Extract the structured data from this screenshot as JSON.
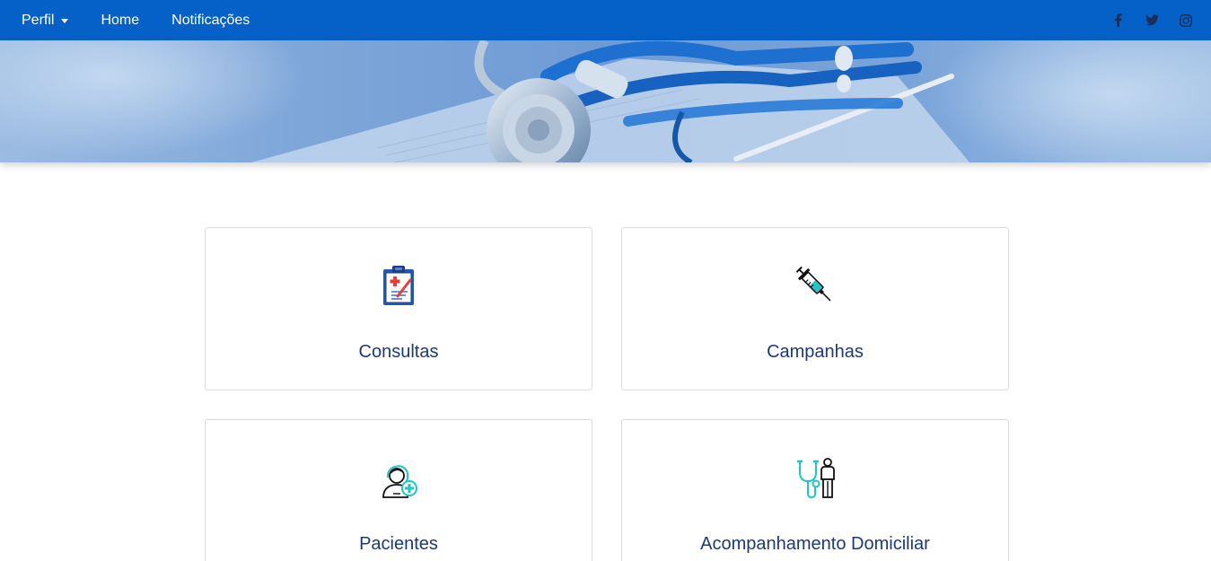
{
  "navbar": {
    "items": [
      {
        "label": "Perfil",
        "dropdown": true
      },
      {
        "label": "Home"
      },
      {
        "label": "Notificações"
      }
    ],
    "social": [
      "facebook-icon",
      "twitter-icon",
      "instagram-icon"
    ],
    "background_color": "#0561c7"
  },
  "hero": {
    "image": "stethoscope-banner"
  },
  "cards": [
    {
      "title": "Consultas",
      "icon": "clipboard-icon"
    },
    {
      "title": "Campanhas",
      "icon": "syringe-icon"
    },
    {
      "title": "Pacientes",
      "icon": "patient-icon"
    },
    {
      "title": "Acompanhamento Domiciliar",
      "icon": "home-care-icon"
    }
  ],
  "colors": {
    "card_title": "#1a3a7c",
    "accent": "#1ec6c8"
  }
}
